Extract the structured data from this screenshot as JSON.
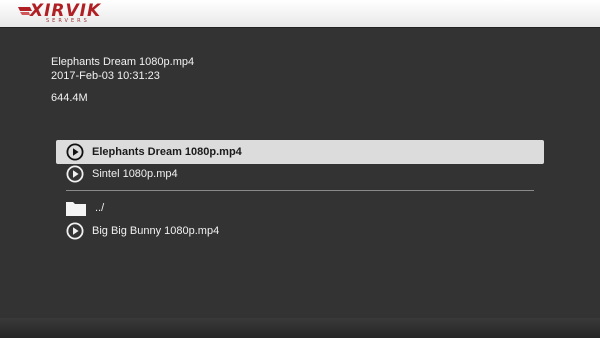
{
  "header": {
    "logo_text": "XIRVIK",
    "logo_subtext": "SERVERS",
    "logo_color": "#b01f24"
  },
  "details": {
    "filename": "Elephants Dream 1080p.mp4",
    "date": "2017-Feb-03 10:31:23",
    "size": "644.4M"
  },
  "files": [
    {
      "label": "Elephants Dream 1080p.mp4",
      "icon": "play-icon",
      "selected": true
    },
    {
      "label": "Sintel 1080p.mp4",
      "icon": "play-icon",
      "selected": false
    },
    {
      "label": "../",
      "icon": "folder-icon",
      "selected": false
    },
    {
      "label": "Big Big Bunny 1080p.mp4",
      "icon": "play-icon",
      "selected": false
    }
  ],
  "colors": {
    "background": "#333333",
    "selected_row": "#dcdcdc",
    "text": "#f0f0f0"
  }
}
